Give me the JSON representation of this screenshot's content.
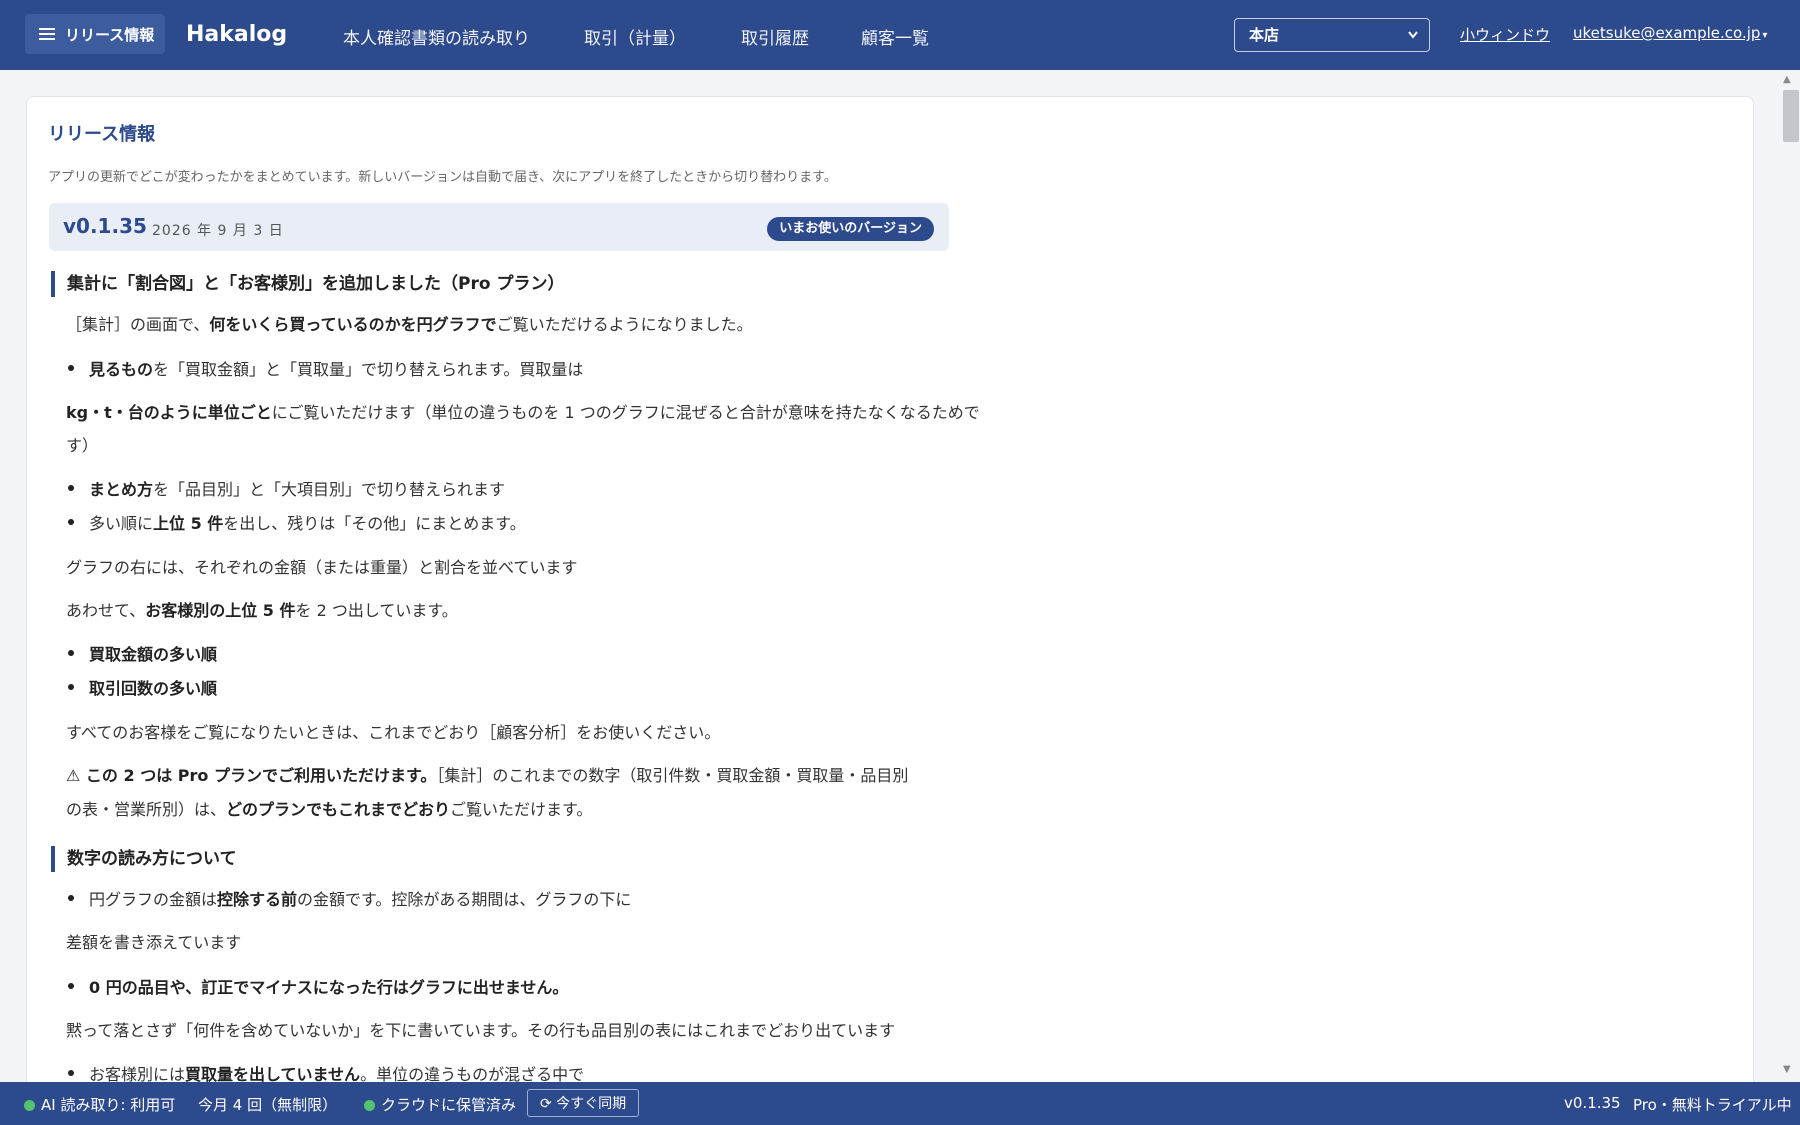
{
  "header": {
    "menu_label": "リリース情報",
    "brand": "Hakalog",
    "nav": [
      "本人確認書類の読み取り",
      "取引（計量）",
      "取引履歴",
      "顧客一覧"
    ],
    "store": "本店",
    "mini_window": "小ウィンドウ",
    "user": "uketsuke@example.co.jp",
    "user_caret": "▾"
  },
  "page": {
    "title": "リリース情報",
    "description": "アプリの更新でどこが変わったかをまとめています。新しいバージョンは自動で届き、次にアプリを終了したときから切り替わります。"
  },
  "release": {
    "version": "v0.1.35",
    "date": "2026 年 9 月 3 日",
    "badge": "いまお使いのバージョン"
  },
  "s1": {
    "heading": "集計に「割合図」と「お客様別」を追加しました（Pro プラン）",
    "intro_a": "［集計］の画面で、",
    "intro_b": "何をいくら買っているのかを円グラフで",
    "intro_c": "ご覧いただけるようになりました。",
    "b1_a": "見るもの",
    "b1_b": "を「買取金額」と「買取量」で切り替えられます。買取量は",
    "p1_a": "kg・t・台のように単位ごと",
    "p1_b": "にご覧いただけます（単位の違うものを 1 つのグラフに混ぜると合計が意味を持たなくなるためで",
    "p1_c": "す）",
    "b2_a": "まとめ方",
    "b2_b": "を「品目別」と「大項目別」で切り替えられます",
    "b3_a": "多い順に",
    "b3_b": "上位 5 件",
    "b3_c": "を出し、残りは「その他」にまとめます。",
    "p2": "グラフの右には、それぞれの金額（または重量）と割合を並べています",
    "p3_a": "あわせて、",
    "p3_b": "お客様別の上位 5 件",
    "p3_c": "を 2 つ出しています。",
    "b4": "買取金額の多い順",
    "b5": "取引回数の多い順",
    "p4": "すべてのお客様をご覧になりたいときは、これまでどおり［顧客分析］をお使いください。",
    "p5_a": "⚠ この 2 つは Pro プランでご利用いただけます。",
    "p5_b": "［集計］のこれまでの数字（取引件数・買取金額・買取量・品目別",
    "p5_c": "の表・営業所別）は、",
    "p5_d": "どのプランでもこれまでどおり",
    "p5_e": "ご覧いただけます。"
  },
  "s2": {
    "heading": "数字の読み方について",
    "b1_a": "円グラフの金額は",
    "b1_b": "控除する前",
    "b1_c": "の金額です。控除がある期間は、グラフの下に",
    "p1": "差額を書き添えています",
    "b2": "0 円の品目や、訂正でマイナスになった行はグラフに出せません。",
    "p2": "黙って落とさず「何件を含めていないか」を下に書いています。その行も品目別の表にはこれまでどおり出ています",
    "b3_a": "お客様別には",
    "b3_b": "買取量を出していません",
    "b3_c": "。単位の違うものが混ざる中で"
  },
  "status": {
    "ai": "AI 読み取り: 利用可",
    "count": "今月 4 回（無制限）",
    "cloud": "クラウドに保管済み",
    "sync": "⟳ 今すぐ同期",
    "version": "v0.1.35",
    "plan": "Pro・無料トライアル中"
  },
  "scrollbar": {
    "up": "▲",
    "down": "▼"
  },
  "colors": {
    "primary": "#2c4a8c",
    "badge_bg": "#e8edf6",
    "ok": "#52c470"
  }
}
